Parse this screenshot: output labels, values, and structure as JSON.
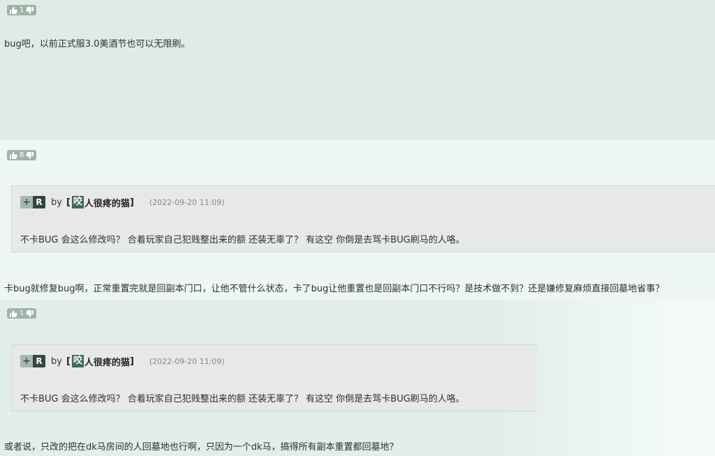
{
  "posts": [
    {
      "votes": "1",
      "content": "bug吧，以前正式服3.0美酒节也可以无限刷。"
    },
    {
      "votes": "8",
      "quote": {
        "plus": "+",
        "tag": "R",
        "by": "by",
        "bracket_open": "[",
        "user_first": "咬",
        "user_rest": "人很疼的猫",
        "bracket_close": "]",
        "time": "(2022-09-20 11:09)",
        "text": "不卡BUG 会这么修改吗？ 合着玩家自己犯贱整出来的额 还装无辜了？ 有这空 你倒是去骂卡BUG刷马的人咯。"
      },
      "content": "卡bug就修复bug啊，正常重置完就是回副本门口，让他不管什么状态，卡了bug让他重置也是回副本门口不行吗？是技术做不到？还是嫌修复麻烦直接回墓地省事？"
    },
    {
      "votes": "1",
      "quote": {
        "plus": "+",
        "tag": "R",
        "by": "by",
        "bracket_open": "[",
        "user_first": "咬",
        "user_rest": "人很疼的猫",
        "bracket_close": "]",
        "time": "(2022-09-20 11:09)",
        "text": "不卡BUG 会这么修改吗？ 合着玩家自己犯贱整出来的额 还装无辜了？ 有这空 你倒是去骂卡BUG刷马的人咯。"
      },
      "content": "或者说，只改的把在dk马房间的人回墓地也行啊，只因为一个dk马，搞得所有副本重置都回墓地？"
    }
  ],
  "icons": {
    "upvote": "thumbs-up-icon",
    "downvote": "thumbs-down-icon"
  }
}
